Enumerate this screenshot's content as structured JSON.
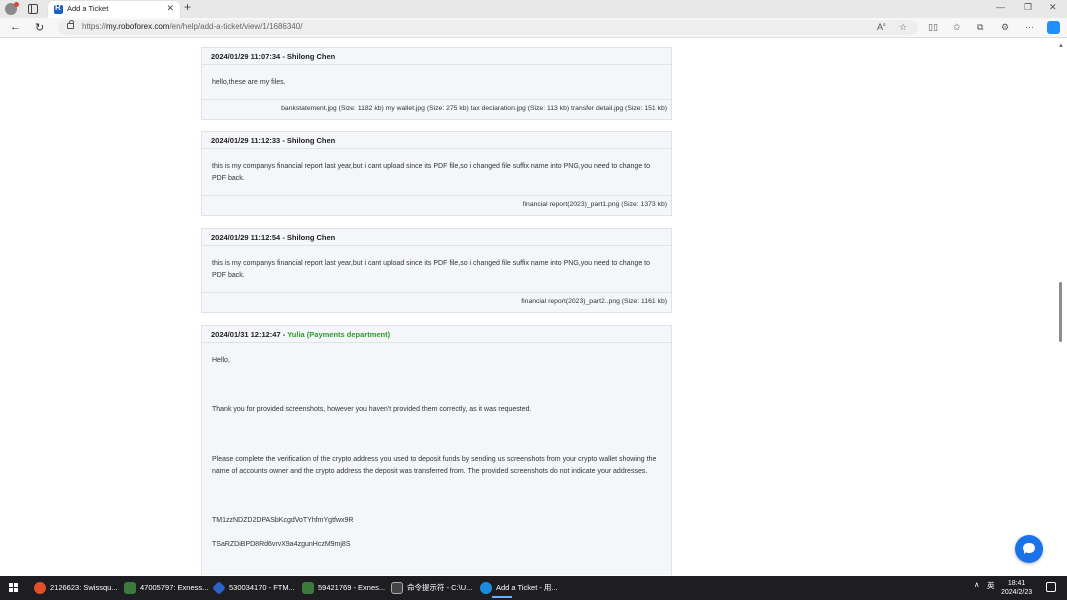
{
  "browser": {
    "tab_title": "Add a Ticket",
    "url_scheme": "https://",
    "url_host": "my.roboforex.com",
    "url_path": "/en/help/add-a-ticket/view/1/1686340/"
  },
  "messages": [
    {
      "timestamp": "2024/01/29 11:07:34",
      "separator": " - ",
      "author": "Shilong Chen",
      "body": [
        "hello,these are my files."
      ],
      "files": "bankstatement.jpg (Size: 1182 kb) my wallet.jpg (Size: 275 kb) tax declaration.jpg (Size: 113 kb) transfer detail.jpg (Size: 151 kb)"
    },
    {
      "timestamp": "2024/01/29 11:12:33",
      "separator": " - ",
      "author": "Shilong Chen",
      "body": [
        "this is my companys  financial report last year,but i cant upload since its PDF file,so i changed  file suffix name into PNG,you need to change to PDF back."
      ],
      "files": "financial report(2023)_part1.png (Size: 1373 kb)"
    },
    {
      "timestamp": "2024/01/29 11:12:54",
      "separator": " - ",
      "author": "Shilong Chen",
      "body": [
        "this is my companys  financial report last year,but i cant upload since its PDF file,so i changed  file suffix name into PNG,you need to change to PDF back."
      ],
      "files": "financial report(2023)_part2..png (Size: 1161 kb)"
    },
    {
      "timestamp": "2024/01/31 12:12:47",
      "separator": " - ",
      "author": "Yulia (Payments department)",
      "body": [
        "Hello,",
        "Thank you for provided screenshots, however you haven't provided them correctly, as it was requested.",
        "Please complete the verification of the crypto address you used to deposit funds by sending us screenshots from your crypto wallet showing the name of accounts owner and the crypto address the deposit was transferred from. The provided screenshots do not indicate your addresses.",
        "TM1zzNDZD2DPASbKcgdVoTYhfmYgtfwx9R",
        "TSaRZDiBPD8Rd6vrvX9a4zgunHczM9mj8S"
      ]
    }
  ],
  "taskbar": {
    "items": [
      {
        "label": "2126623: Swissqu...",
        "color": "#e0502a"
      },
      {
        "label": "47005797: Exness...",
        "color": "#3c7a3c"
      },
      {
        "label": "530034170 - FTM...",
        "color": "#2a62c9"
      },
      {
        "label": "59421769 - Exnes...",
        "color": "#3c7a3c"
      },
      {
        "label": "命令提示符 - C:\\U...",
        "color": "#444444"
      },
      {
        "label": "Add a Ticket - 用...",
        "color": "#1b8be0"
      }
    ],
    "ime": "英",
    "time": "18:41",
    "date": "2024/2/23"
  }
}
